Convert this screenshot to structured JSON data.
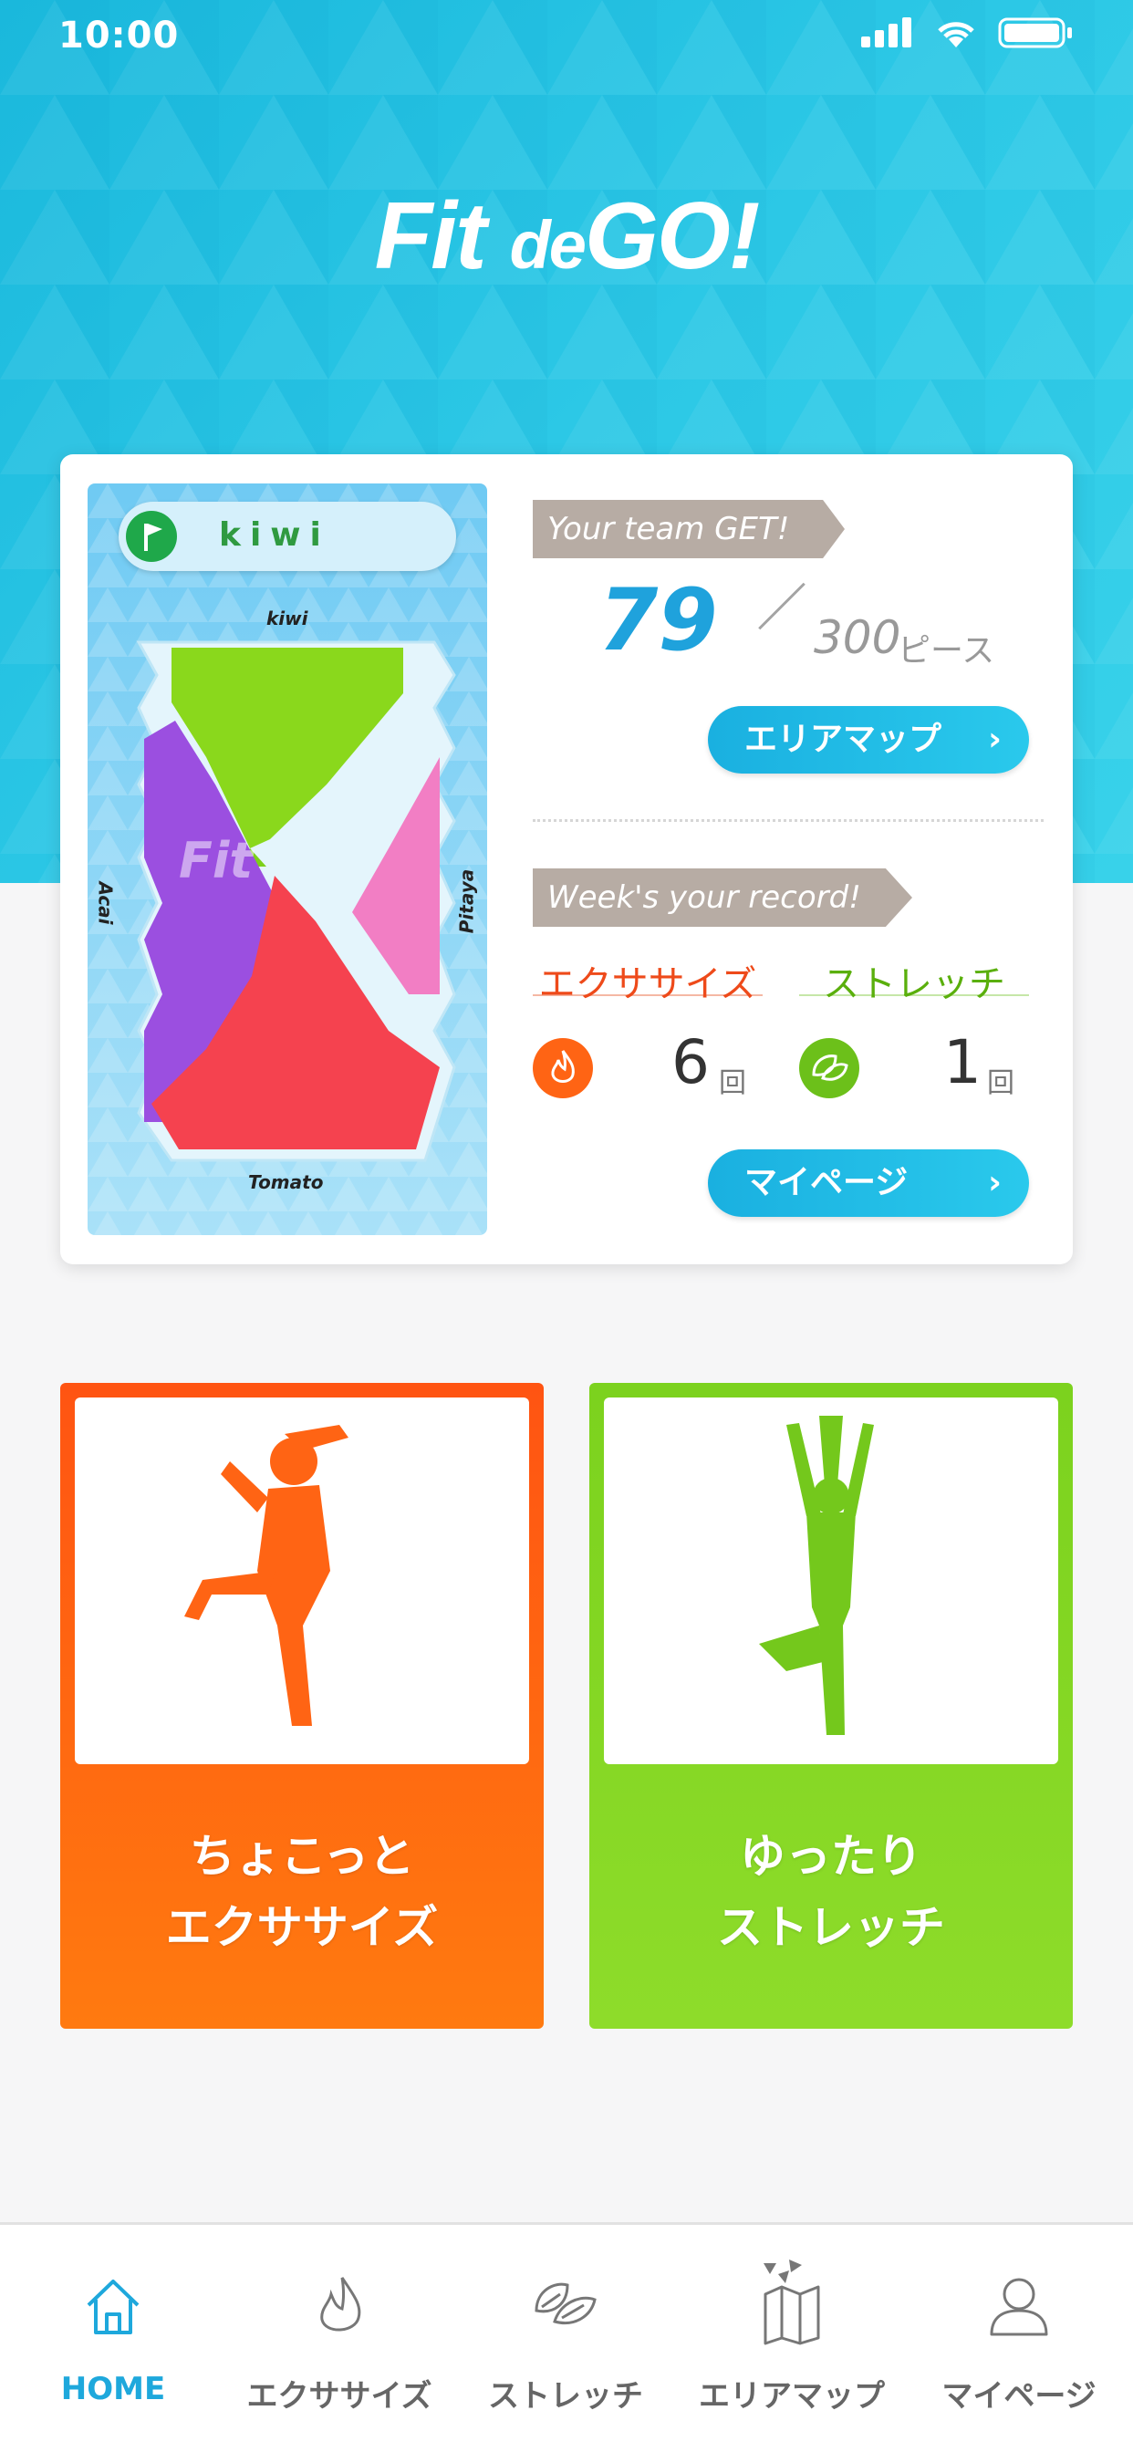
{
  "status_bar": {
    "time": "10:00"
  },
  "app": {
    "logo_main": "Fit",
    "logo_de": "de",
    "logo_go": "GO!"
  },
  "map": {
    "area_name": "kiwi",
    "labels": {
      "top": "kiwi",
      "left": "Acai",
      "right": "Pitaya",
      "bottom": "Tomato"
    }
  },
  "team": {
    "tag": "Your team GET!",
    "count": "79",
    "total": "300",
    "unit": "ピース",
    "area_map_button": "エリアマップ"
  },
  "record": {
    "tag": "Week's your record!",
    "exercise_label": "エクササイズ",
    "stretch_label": "ストレッチ",
    "exercise_count": "6",
    "stretch_count": "1",
    "count_unit": "回",
    "mypage_button": "マイページ"
  },
  "tiles": {
    "exercise": {
      "line1": "ちょこっと",
      "line2": "エクササイズ"
    },
    "stretch": {
      "line1": "ゆったり",
      "line2": "ストレッチ"
    }
  },
  "tabbar": {
    "items": [
      {
        "label": "HOME",
        "icon": "home-icon"
      },
      {
        "label": "エクササイズ",
        "icon": "flame-icon"
      },
      {
        "label": "ストレッチ",
        "icon": "leaf-icon"
      },
      {
        "label": "エリアマップ",
        "icon": "map-icon"
      },
      {
        "label": "マイページ",
        "icon": "person-icon"
      }
    ]
  },
  "colors": {
    "brand_blue": "#1fa2dc",
    "exercise_orange": "#ff5a14",
    "stretch_green": "#74c81c"
  }
}
